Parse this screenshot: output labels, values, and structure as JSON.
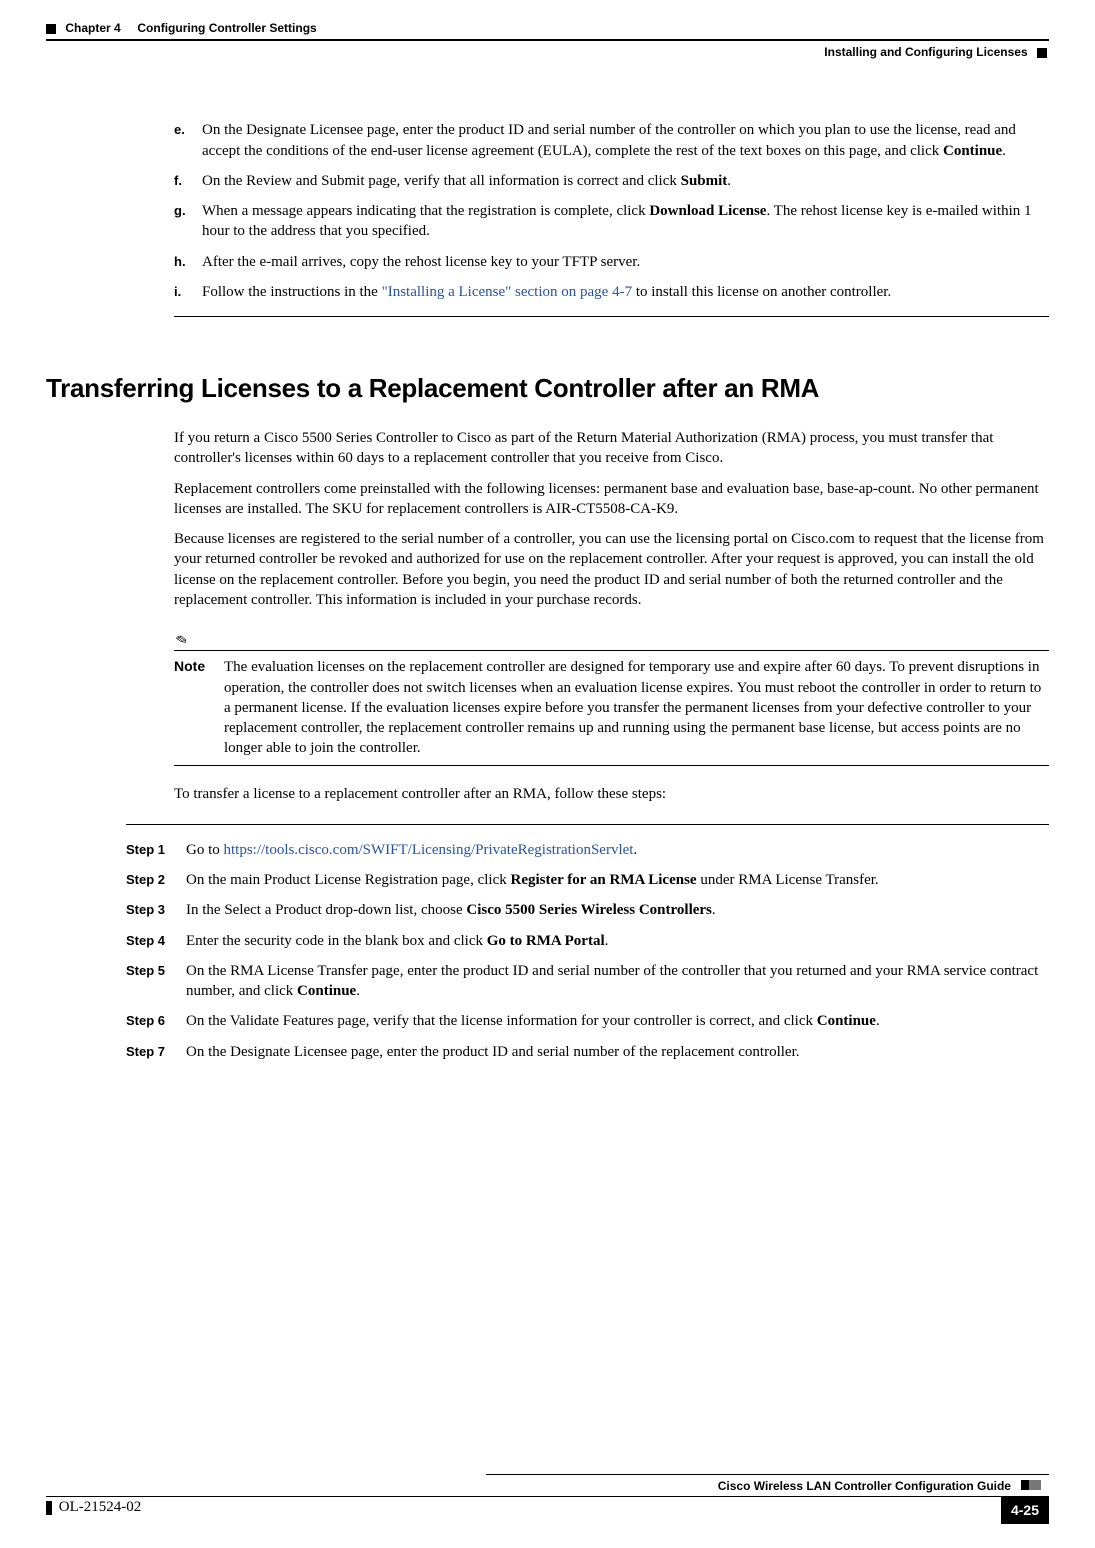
{
  "header": {
    "chapter": "Chapter 4",
    "chapter_title": "Configuring Controller Settings",
    "subtitle": "Installing and Configuring Licenses"
  },
  "substeps": [
    {
      "label": "e.",
      "text_pre": "On the Designate Licensee page, enter the product ID and serial number of the controller on which you plan to use the license, read and accept the conditions of the end-user license agreement (EULA), complete the rest of the text boxes on this page, and click ",
      "bold": "Continue",
      "text_post": "."
    },
    {
      "label": "f.",
      "text_pre": "On the Review and Submit page, verify that all information is correct and click ",
      "bold": "Submit",
      "text_post": "."
    },
    {
      "label": "g.",
      "text_pre": "When a message appears indicating that the registration is complete, click ",
      "bold": "Download License",
      "text_post": ". The rehost license key is e-mailed within 1 hour to the address that you specified."
    },
    {
      "label": "h.",
      "text_pre": "After the e-mail arrives, copy the rehost license key to your TFTP server.",
      "bold": "",
      "text_post": ""
    },
    {
      "label": "i.",
      "text_pre": "Follow the instructions in the ",
      "link": "\"Installing a License\" section on page 4-7",
      "text_post": " to install this license on another controller."
    }
  ],
  "section_heading": "Transferring Licenses to a Replacement Controller after an RMA",
  "paragraphs": [
    "If you return a Cisco 5500 Series Controller to Cisco as part of the Return Material Authorization (RMA) process, you must transfer that controller's licenses within 60 days to a replacement controller that you receive from Cisco.",
    "Replacement controllers come preinstalled with the following licenses: permanent base and evaluation base, base-ap-count. No other permanent licenses are installed. The SKU for replacement controllers is AIR-CT5508-CA-K9.",
    "Because licenses are registered to the serial number of a controller, you can use the licensing portal on Cisco.com to request that the license from your returned controller be revoked and authorized for use on the replacement controller. After your request is approved, you can install the old license on the replacement controller. Before you begin, you need the product ID and serial number of both the returned controller and the replacement controller. This information is included in your purchase records."
  ],
  "note": {
    "label": "Note",
    "text": "The evaluation licenses on the replacement controller are designed for temporary use and expire after 60 days. To prevent disruptions in operation, the controller does not switch licenses when an evaluation license expires. You must reboot the controller in order to return to a permanent license. If the evaluation licenses expire before you transfer the permanent licenses from your defective controller to your replacement controller, the replacement controller remains up and running using the permanent base license, but access points are no longer able to join the controller."
  },
  "intro_after_note": "To transfer a license to a replacement controller after an RMA, follow these steps:",
  "steps": [
    {
      "label": "Step 1",
      "text_pre": "Go to ",
      "link": "https://tools.cisco.com/SWIFT/Licensing/PrivateRegistrationServlet",
      "text_post": "."
    },
    {
      "label": "Step 2",
      "text_pre": "On the main Product License Registration page, click ",
      "bold": "Register for an RMA License",
      "text_post": " under RMA License Transfer."
    },
    {
      "label": "Step 3",
      "text_pre": "In the Select a Product drop-down list, choose ",
      "bold": "Cisco 5500 Series Wireless Controllers",
      "text_post": "."
    },
    {
      "label": "Step 4",
      "text_pre": "Enter the security code in the blank box and click ",
      "bold": "Go to RMA Portal",
      "text_post": "."
    },
    {
      "label": "Step 5",
      "text_pre": "On the RMA License Transfer page, enter the product ID and serial number of the controller that you returned and your RMA service contract number, and click ",
      "bold": "Continue",
      "text_post": "."
    },
    {
      "label": "Step 6",
      "text_pre": "On the Validate Features page, verify that the license information for your controller is correct, and click ",
      "bold": "Continue",
      "text_post": "."
    },
    {
      "label": "Step 7",
      "text_pre": "On the Designate Licensee page, enter the product ID and serial number of the replacement controller.",
      "bold": "",
      "text_post": ""
    }
  ],
  "footer": {
    "guide": "Cisco Wireless LAN Controller Configuration Guide",
    "docnum": "OL-21524-02",
    "pagenum": "4-25"
  }
}
